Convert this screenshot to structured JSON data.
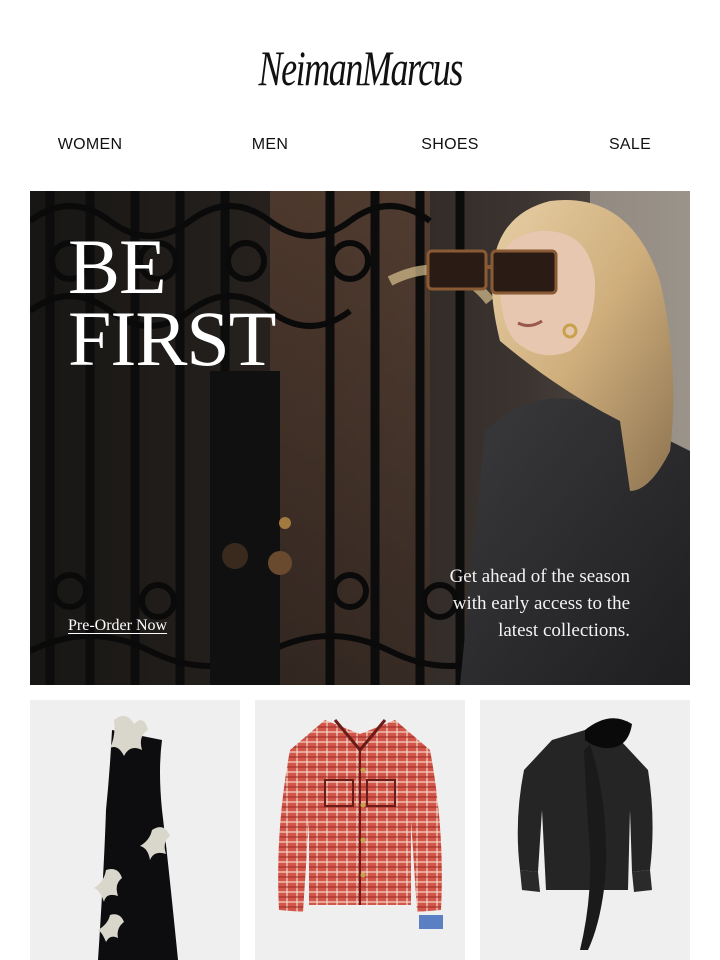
{
  "header": {
    "logo_text": "NeimanMarcus"
  },
  "nav": {
    "items": [
      "WOMEN",
      "MEN",
      "SHOES",
      "SALE"
    ]
  },
  "hero": {
    "title_lines": [
      "BE",
      "FIRST"
    ],
    "copy_lines": [
      "Get ahead of the season",
      "with early access to the",
      "latest collections."
    ],
    "cta_label": "Pre-Order Now"
  },
  "products": [
    {
      "icon": "black-embellished-gown-icon"
    },
    {
      "icon": "red-plaid-jacket-icon"
    },
    {
      "icon": "black-bow-blouse-icon"
    }
  ]
}
